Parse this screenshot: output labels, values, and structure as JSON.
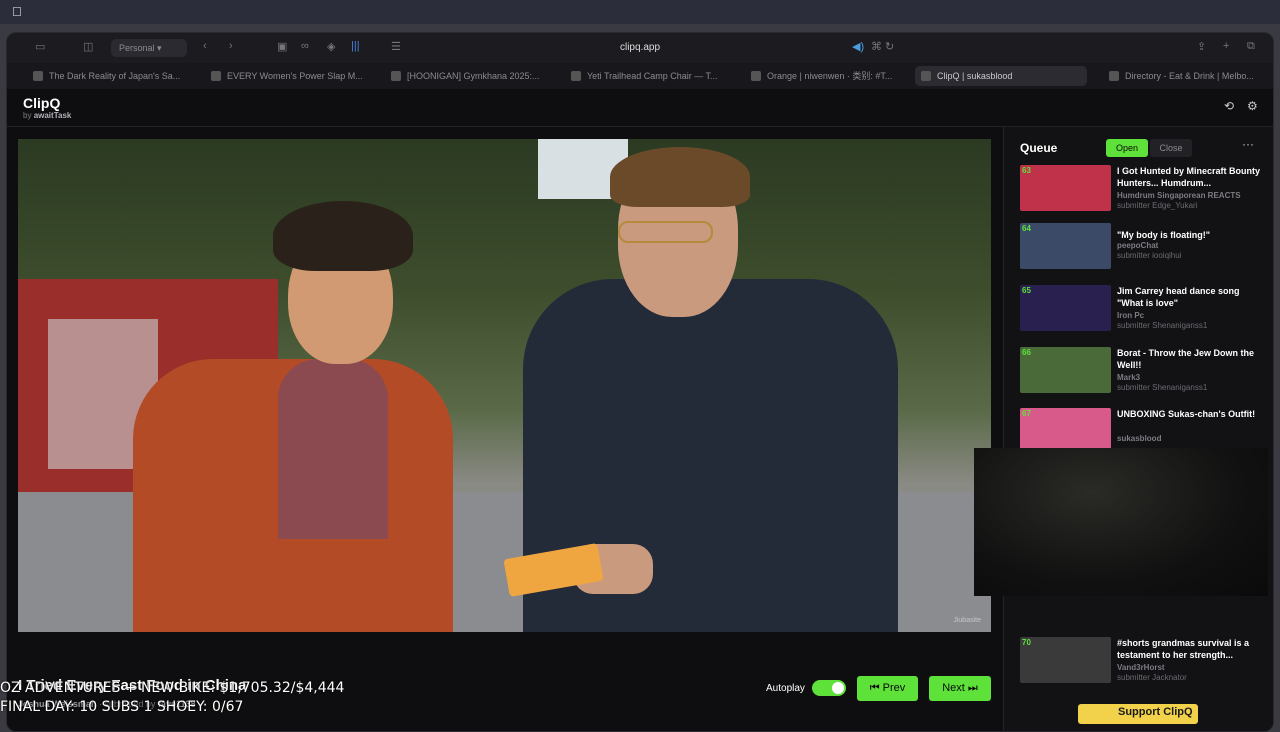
{
  "browser": {
    "profile": "Personal",
    "url": "clipq.app",
    "tabs": [
      "The Dark Reality of Japan's Sa...",
      "EVERY Women's Power Slap M...",
      "[HOONIGAN] Gymkhana 2025:...",
      "Yeti Trailhead Camp Chair — T...",
      "Orange | niwenwen · 类别: #T...",
      "ClipQ | sukasblood",
      "Directory - Eat & Drink | Melbo..."
    ]
  },
  "app": {
    "logo": "ClipQ",
    "by_prefix": "by",
    "by_author": "awaitTask"
  },
  "video": {
    "title": "I Tried Every Fast Food in China",
    "channel": "Joshua Weissman",
    "submitted_prefix": "· submitted by",
    "submitter": "faye1138",
    "watermark": "Jiubasite",
    "autoplay_label": "Autoplay",
    "autoplay_on": true,
    "prev_label": "⏮ Prev",
    "next_label": "Next ⏭"
  },
  "queue": {
    "title": "Queue",
    "open_label": "Open",
    "close_label": "Close",
    "more_icon": "more-dots-icon",
    "items": [
      {
        "num": "63",
        "title": "I Got Hunted by Minecraft Bounty Hunters... Humdrum...",
        "channel": "Humdrum Singaporean REACTS",
        "submitter": "submitter Edge_Yukari",
        "color": "#c0324a"
      },
      {
        "num": "64",
        "title": "\"My body is floating!\"",
        "channel": "peepoChat",
        "submitter": "submitter iooiqihui",
        "color": "#3b4a66"
      },
      {
        "num": "65",
        "title": "Jim Carrey head dance song \"What is love\"",
        "channel": "Iron Pc",
        "submitter": "submitter Shenaniganss1",
        "color": "#2a2050"
      },
      {
        "num": "66",
        "title": "Borat - Throw the Jew Down the Well!!",
        "channel": "Mark3",
        "submitter": "submitter Shenaniganss1",
        "color": "#4a6a3a"
      },
      {
        "num": "67",
        "title": "UNBOXING Sukas-chan's Outfit!",
        "channel": "sukasblood",
        "submitter": "",
        "color": "#d85a8a"
      },
      {
        "num": "70",
        "title": "#shorts grandmas survival is a testament to her strength...",
        "channel": "Vand3rHorst",
        "submitter": "submitter Jacknator",
        "color": "#3a3a3a"
      }
    ]
  },
  "support_label": "Support ClipQ",
  "stream_overlay": {
    "line1": "OZ ADVENTURES + NEW BIKE: $1,705.32/$4,444",
    "line2": "FINAL DAY: 10 SUBS 1 SHOEY: 0/67"
  }
}
